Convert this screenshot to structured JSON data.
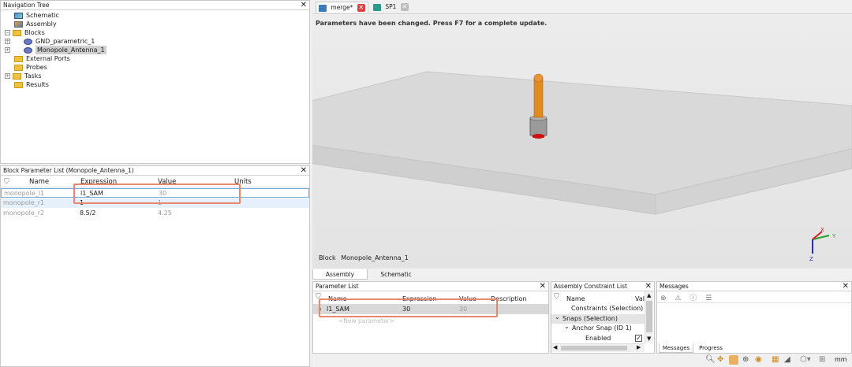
{
  "nav_tree": {
    "title": "Navigation Tree",
    "items": [
      {
        "label": "Schematic",
        "indent": 1,
        "icon": "schematic-icon"
      },
      {
        "label": "Assembly",
        "indent": 1,
        "icon": "assembly-icon"
      },
      {
        "label": "Blocks",
        "indent": 0,
        "icon": "folder-icon",
        "expander": "−"
      },
      {
        "label": "GND_parametric_1",
        "indent": 1,
        "icon": "block-icon",
        "expander": "+"
      },
      {
        "label": "Monopole_Antenna_1",
        "indent": 1,
        "icon": "block-icon",
        "expander": "+",
        "selected": true
      },
      {
        "label": "External Ports",
        "indent": 1,
        "icon": "folder-icon"
      },
      {
        "label": "Probes",
        "indent": 1,
        "icon": "folder-icon"
      },
      {
        "label": "Tasks",
        "indent": 0,
        "icon": "folder-icon",
        "expander": "+"
      },
      {
        "label": "Results",
        "indent": 1,
        "icon": "folder-icon"
      }
    ]
  },
  "block_params": {
    "title": "Block Parameter List (Monopole_Antenna_1)",
    "headers": [
      "Name",
      "Expression",
      "Value",
      "Units"
    ],
    "rows": [
      {
        "name": "monopole_l1",
        "expression": "l1_SAM",
        "value": "30"
      },
      {
        "name": "monopole_r1",
        "expression": "1",
        "value": "1"
      },
      {
        "name": "monopole_r2",
        "expression": "8.5/2",
        "value": "4.25"
      }
    ]
  },
  "editor_tabs": [
    {
      "label": "merge*",
      "active": true
    },
    {
      "label": "SP1",
      "active": false
    }
  ],
  "viewport": {
    "notice": "Parameters have been changed. Press F7 for a complete update.",
    "status_label": "Block",
    "status_value": "Monopole_Antenna_1",
    "axes": {
      "x": "X",
      "y": "Y",
      "z": "Z"
    }
  },
  "view_tabs": [
    "Assembly",
    "Schematic"
  ],
  "parameter_list": {
    "title": "Parameter List",
    "headers": [
      "Name",
      "Expression",
      "Value",
      "Description"
    ],
    "rows": [
      {
        "name": "l1_SAM",
        "expression": "30",
        "value": "30"
      }
    ],
    "new_placeholder": "<New parameter>"
  },
  "constraint_list": {
    "title": "Assembly Constraint List",
    "headers": [
      "Name",
      "Val"
    ],
    "rows": [
      {
        "label": "Constraints (Selection)",
        "indent": 1,
        "expander": ""
      },
      {
        "label": "Snaps (Selection)",
        "indent": 0,
        "expander": "⌄"
      },
      {
        "label": "Anchor Snap (ID 1)",
        "indent": 1,
        "expander": "⌄"
      },
      {
        "label": "Enabled",
        "indent": 3,
        "expander": "",
        "checked": true
      }
    ]
  },
  "messages": {
    "title": "Messages",
    "tabs": [
      "Messages",
      "Progress"
    ]
  },
  "status_bar": {
    "unit": "mm"
  },
  "colors": {
    "highlight": "#e8876a",
    "antenna": "#e08a20",
    "selection": "#cfe4f7"
  }
}
